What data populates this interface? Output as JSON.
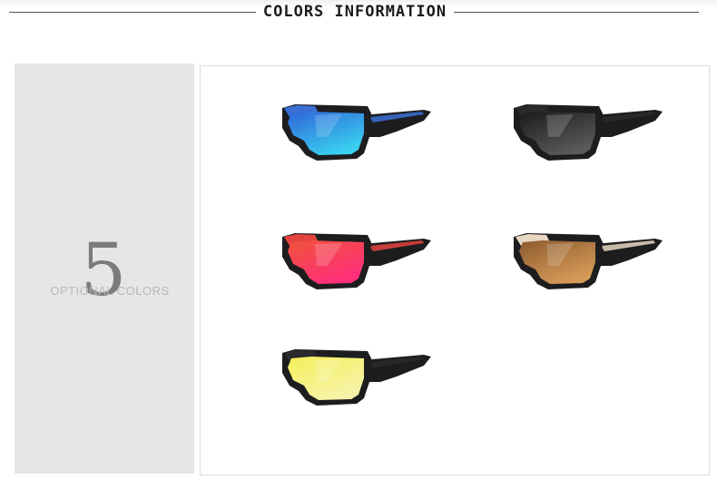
{
  "header": {
    "title": "COLORS INFORMATION"
  },
  "sidebar": {
    "count": "5",
    "count_label": "OPTIONAL COLORS"
  },
  "colors": [
    {
      "icon": "sunglasses-blue-mirror-icon",
      "frame": "#1d1d1f",
      "accent": "#3b6fd6",
      "lens_top": "#2f64d8",
      "lens_bottom": "#39d0f0"
    },
    {
      "icon": "sunglasses-black-icon",
      "frame": "#1d1d1f",
      "accent": "#2a2a2c",
      "lens_top": "#1a1a1a",
      "lens_bottom": "#5a5a5c"
    },
    {
      "icon": "sunglasses-red-mirror-icon",
      "frame": "#1d1d1f",
      "accent": "#e4433f",
      "lens_top": "#f0533a",
      "lens_bottom": "#ff2f7a"
    },
    {
      "icon": "sunglasses-brown-icon",
      "frame": "#1d1d1f",
      "accent": "#e8d7c2",
      "lens_top": "#8b5a2e",
      "lens_bottom": "#d79b58"
    },
    {
      "icon": "sunglasses-yellow-night-icon",
      "frame": "#1d1d1f",
      "accent": "#2a2a2c",
      "lens_top": "#f4f05a",
      "lens_bottom": "#f6f3a8"
    }
  ]
}
